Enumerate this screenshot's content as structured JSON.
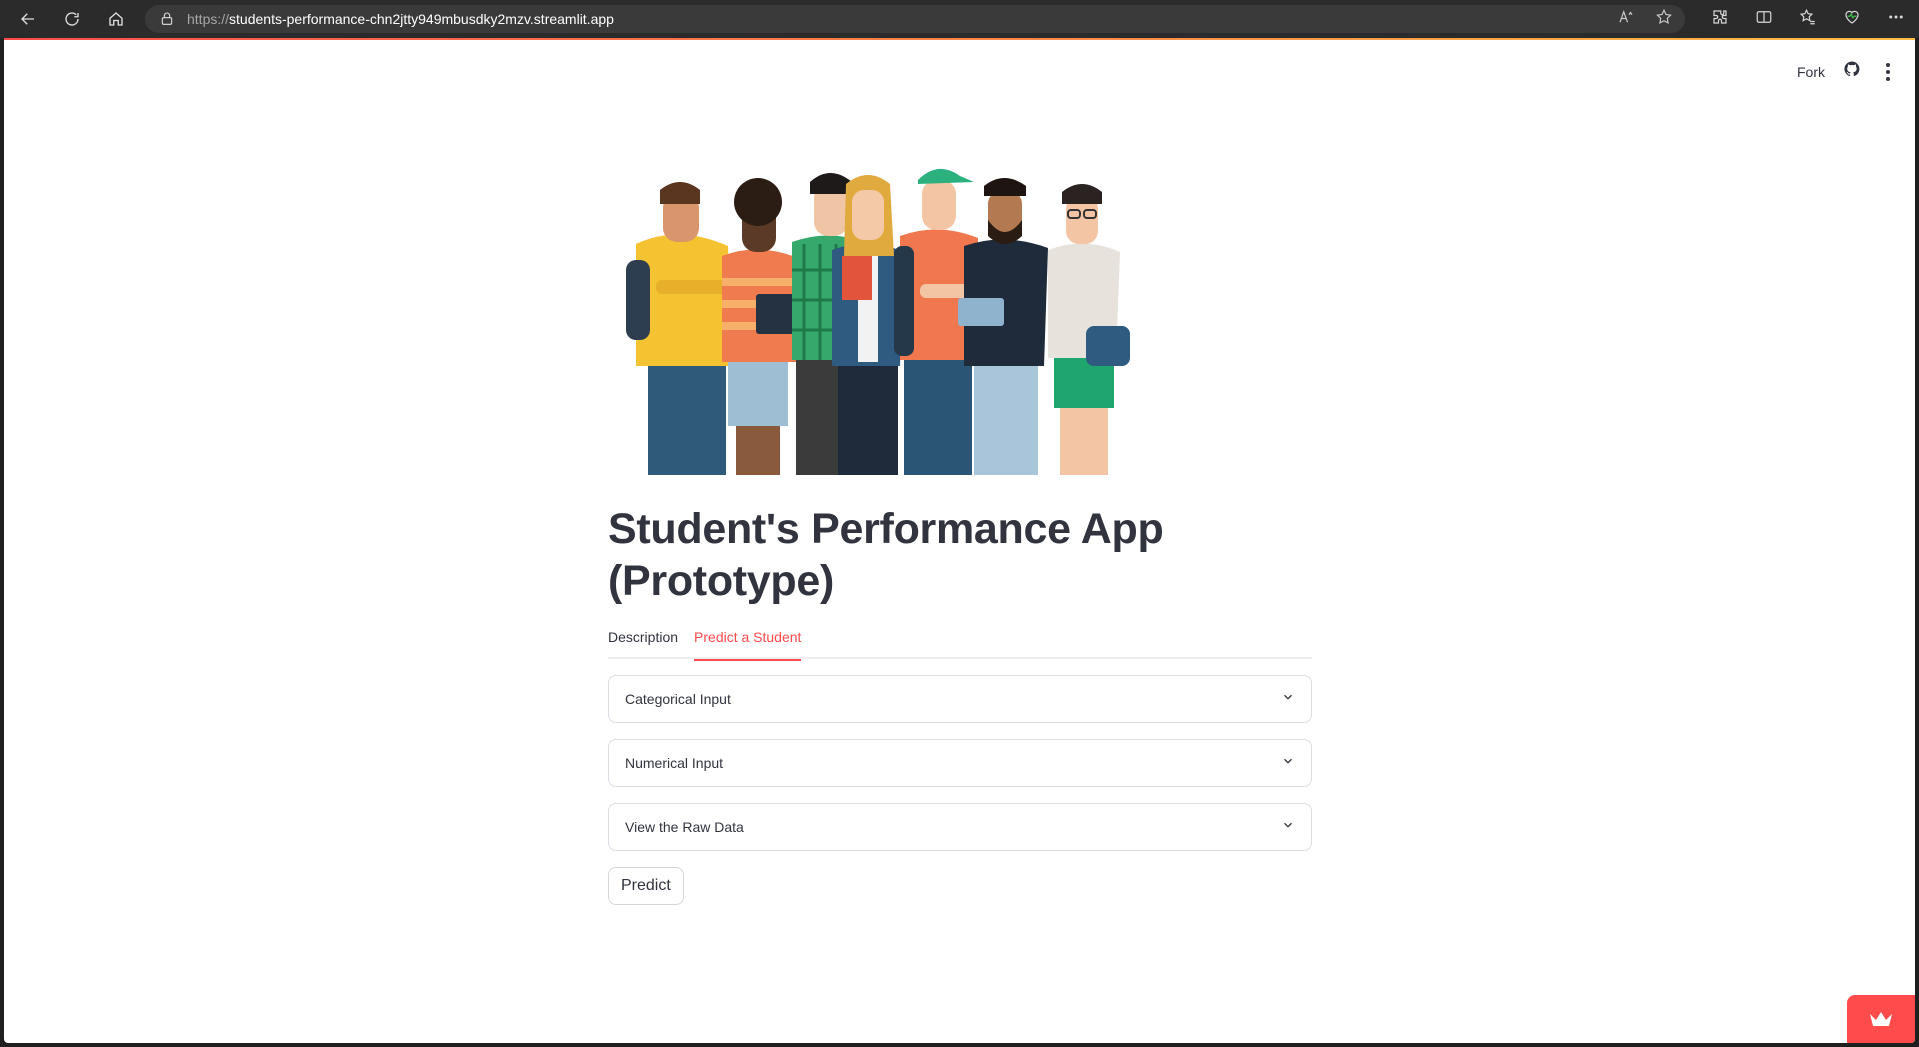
{
  "browser": {
    "url_scheme": "https://",
    "url_host": "students-performance-chn2jtty949mbusdky2mzv.streamlit.app",
    "read_aloud_label": "Aᵃ"
  },
  "header": {
    "fork_label": "Fork"
  },
  "page": {
    "title": "Student's Performance App (Prototype)",
    "tabs": [
      {
        "label": "Description",
        "active": false
      },
      {
        "label": "Predict a Student",
        "active": true
      }
    ],
    "expanders": [
      {
        "label": "Categorical Input"
      },
      {
        "label": "Numerical Input"
      },
      {
        "label": "View the Raw Data"
      }
    ],
    "predict_button": "Predict"
  },
  "icons": {
    "back": "back-arrow-icon",
    "reload": "reload-icon",
    "home": "home-icon",
    "lock": "lock-icon",
    "read_aloud": "read-aloud-icon",
    "favorite": "star-icon",
    "extensions": "puzzle-icon",
    "split": "split-screen-icon",
    "favorites_bar": "favorites-icon",
    "health": "heart-health-icon",
    "more": "more-dots-icon",
    "github": "github-icon",
    "menu": "vertical-dots-icon",
    "streamlit": "streamlit-crown-icon"
  },
  "colors": {
    "accent": "#ff4b4b",
    "text": "#31333f",
    "border": "#dcdde3"
  }
}
